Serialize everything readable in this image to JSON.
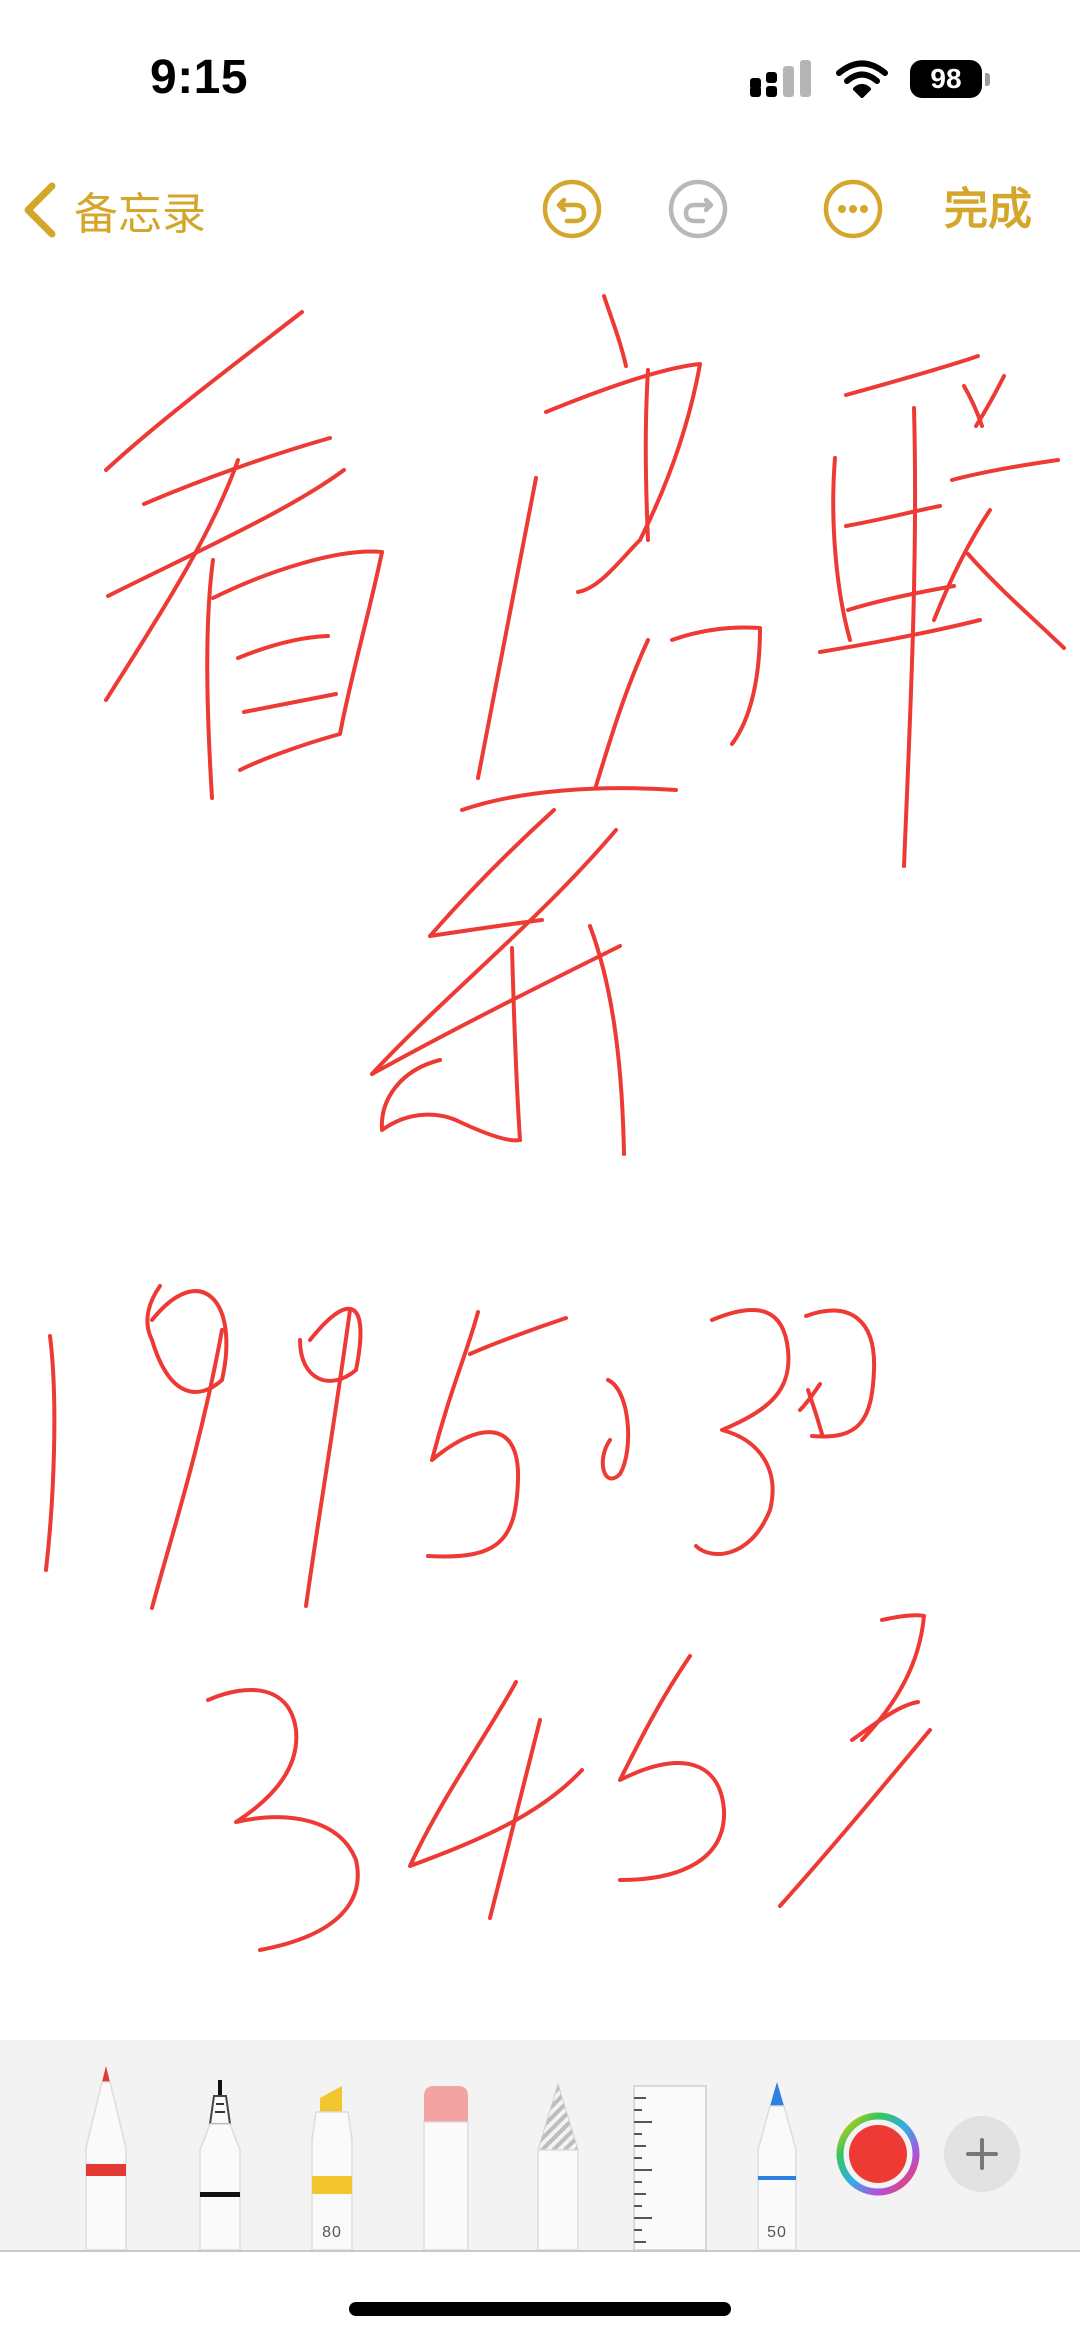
{
  "status_bar": {
    "time": "9:15",
    "battery_level": "98",
    "icons": [
      "signal-icon",
      "wifi-icon",
      "battery-icon"
    ]
  },
  "nav": {
    "back_label": "备忘录",
    "done_label": "完成",
    "icons": [
      "chevron-left-icon",
      "undo-icon",
      "redo-icon",
      "more-icon"
    ]
  },
  "handwriting": {
    "ink_color": "#ee3a34",
    "content": "看房联系 1995030 3453"
  },
  "tools": {
    "marker_width": "80",
    "pencil_width": "50",
    "items": [
      "pen-tool",
      "fineliner-tool",
      "highlighter-tool",
      "eraser-tool",
      "lasso-tool",
      "ruler-tool",
      "pencil-tool"
    ],
    "selected_color": "#ee3a34"
  },
  "colors": {
    "accent": "#d4a72c",
    "disabled": "#b8b8b8",
    "ink": "#ee3a34"
  }
}
